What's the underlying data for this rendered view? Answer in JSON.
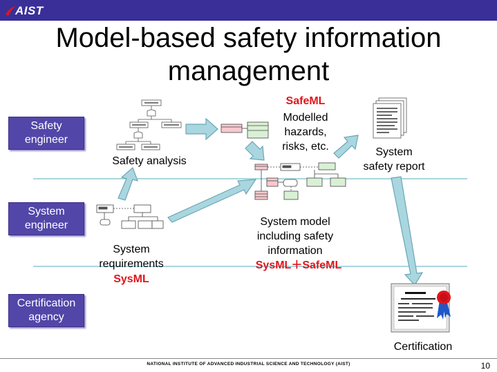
{
  "header": {
    "logo_text": "AIST",
    "bar_color": "#3a2f98"
  },
  "title": {
    "line1": "Model-based safety information",
    "line2": "management"
  },
  "roles": [
    {
      "line1": "Safety",
      "line2": "engineer"
    },
    {
      "line1": "System",
      "line2": "engineer"
    },
    {
      "line1": "Certification",
      "line2": "agency"
    }
  ],
  "labels": {
    "safety_analysis": "Safety analysis",
    "safeml": "SafeML",
    "modelled_1": "Modelled",
    "modelled_2": "hazards,",
    "modelled_3": "risks, etc.",
    "report_1": "System",
    "report_2": "safety report",
    "sysmodel_1": "System model",
    "sysmodel_2": "including safety",
    "sysmodel_3": "information",
    "sysmodel_4": "SysML＋SafeML",
    "req_1": "System",
    "req_2": "requirements",
    "sysml": "SysML",
    "certification": "Certification"
  },
  "footer": {
    "text": "NATIONAL INSTITUTE OF ADVANCED INDUSTRIAL SCIENCE AND TECHNOLOGY (AIST)",
    "page": "10"
  },
  "colors": {
    "arrow_fill": "#a9d6df",
    "arrow_stroke": "#6aa6b6",
    "role_box": "#5246a8",
    "accent_red": "#e0151b",
    "lane_line": "#a9d6df"
  },
  "icons": [
    "logo-swoosh-icon",
    "fault-tree-icon",
    "model-diagram-icon",
    "document-stack-icon",
    "certificate-icon",
    "ribbon-icon"
  ]
}
